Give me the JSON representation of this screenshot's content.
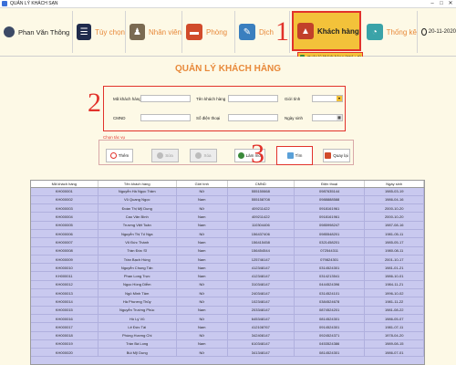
{
  "window": {
    "title": "QUẢN LÝ KHÁCH SẠN"
  },
  "nav": {
    "user": "Phan Văn Thông",
    "items": [
      {
        "key": "options",
        "label": "Tùy chọn"
      },
      {
        "key": "staff",
        "label": "Nhân viên"
      },
      {
        "key": "room",
        "label": "Phòng"
      },
      {
        "key": "service",
        "label": "Dịch"
      },
      {
        "key": "customer",
        "label": "Khách hàng"
      },
      {
        "key": "stats",
        "label": "Thống kê"
      }
    ],
    "date": "20-11-2020",
    "dropdown_item": "Quản lý khách hàng (Ctrl + 8)"
  },
  "annotations": {
    "one": "1",
    "two": "2",
    "three": "3"
  },
  "page": {
    "title": "QUẢN LÝ KHÁCH HÀNG"
  },
  "form": {
    "customer_id_label": "Mã khách hàng",
    "customer_name_label": "Tên khách hàng",
    "gender_label": "Giới tính",
    "id_card_label": "CMND",
    "phone_label": "Số điện thoại",
    "birthday_label": "Ngày sinh"
  },
  "functions": {
    "group_title": "Chọn tác vụ",
    "add": "Thêm",
    "edit": "Sửa",
    "delete": "Xóa",
    "refresh": "Làm mới",
    "search": "Tìm",
    "back": "Quay lại"
  },
  "table": {
    "columns": [
      "Mã khách hàng",
      "Tên khách hàng",
      "Giới tính",
      "CMND",
      "Điện thoại",
      "Ngày sinh"
    ],
    "rows": [
      [
        "KH000001",
        "Nguyễn Hà Ngọc Trâm",
        "Nữ",
        "555150668",
        "0987635144",
        "1985-03-19"
      ],
      [
        "KH000002",
        "Vũ Quang Ngọc",
        "Nam",
        "555158708",
        "0988888588",
        "1986-04-16"
      ],
      [
        "KH000003",
        "Đoàn Thị Mỹ Dung",
        "Nữ",
        "409211422",
        "0918161961",
        "2000-10-20"
      ],
      [
        "KH000004",
        "Cao Văn Bình",
        "Nam",
        "409211422",
        "0918161961",
        "2000-10-20"
      ],
      [
        "KH000005",
        "Trương Việt Toản",
        "Nam",
        "110304406",
        "0985998247",
        "1987-08-16"
      ],
      [
        "KH000006",
        "Nguyễn Thị Tố Nga",
        "Nữ",
        "156437406",
        "0985548201",
        "1981-05-11"
      ],
      [
        "KH000007",
        "Võ Đức Thành",
        "Nam",
        "156415458",
        "0321458201",
        "1985-05-17"
      ],
      [
        "KH000008",
        "Trần Đức Sĩ",
        "Nam",
        "156454544",
        "072544311",
        "1980-08-11"
      ],
      [
        "KH000009",
        "Trần Bạch Hùng",
        "Nam",
        "125746147",
        "079824301",
        "2001-10-17"
      ],
      [
        "KH000010",
        "Nguyễn Chung Tấn",
        "Nam",
        "412348147",
        "0314524301",
        "1981-01-21"
      ],
      [
        "KH000011",
        "Phan Long Trực",
        "Nam",
        "412348147",
        "0314213541",
        "1986-10-01"
      ],
      [
        "KH000012",
        "Ngọc Hồng Diễm",
        "Nữ",
        "310348147",
        "0444524396",
        "1984-11-21"
      ],
      [
        "KH000013",
        "Ngô Minh Tâm",
        "Nữ",
        "240348147",
        "0314524101",
        "1996-10-02"
      ],
      [
        "KH000014",
        "Hà Phương Thủy",
        "Nữ",
        "102348147",
        "0384524678",
        "1981-11-22"
      ],
      [
        "KH000015",
        "Nguyễn Trường Phúc",
        "Nam",
        "203348147",
        "0874524201",
        "1981-08-22"
      ],
      [
        "KH000016",
        "Hồ Lý Vũ",
        "Nữ",
        "645348147",
        "0814524301",
        "1986-05-07"
      ],
      [
        "KH000017",
        "Lê Đức Tài",
        "Nam",
        "412108767",
        "0914524301",
        "1981-07-11"
      ],
      [
        "KH000018",
        "Phùng Hương Chi",
        "Nữ",
        "342408147",
        "0924524371",
        "1978-04-20"
      ],
      [
        "KH000019",
        "Trần Bá Long",
        "Nam",
        "610348147",
        "0453524386",
        "1989-08-15"
      ],
      [
        "KH000020",
        "Bùi Mỹ Dung",
        "Nữ",
        "341348147",
        "0814524301",
        "1986-07-01"
      ]
    ]
  },
  "colors": {
    "accent": "#e8893a",
    "highlight": "#f3c23a",
    "annotation": "#e2322b",
    "grid_bg": "#c9c9ef"
  }
}
